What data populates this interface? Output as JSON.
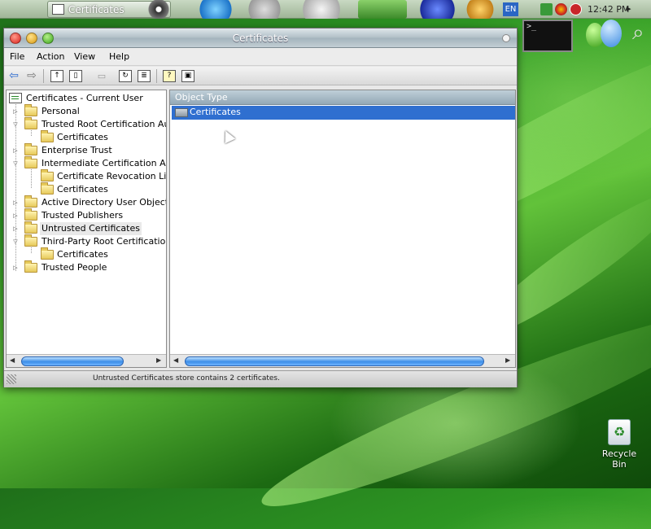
{
  "menubar": {
    "apple_glyph": "",
    "task_label": "Certificates",
    "language": "EN",
    "clock": "12:42 PM",
    "menu_arrow": "▸"
  },
  "desktop": {
    "terminal_prompt": ">_",
    "recycle_bin_label": "Recycle Bin"
  },
  "window": {
    "title": "Certificates",
    "menus": [
      "File",
      "Action",
      "View",
      "Help"
    ]
  },
  "tree": {
    "root": "Certificates - Current User",
    "items": [
      {
        "label": "Personal"
      },
      {
        "label": "Trusted Root Certification Autho"
      },
      {
        "label": "Certificates"
      },
      {
        "label": "Enterprise Trust"
      },
      {
        "label": "Intermediate Certification Autho"
      },
      {
        "label": "Certificate Revocation List"
      },
      {
        "label": "Certificates"
      },
      {
        "label": "Active Directory User Object"
      },
      {
        "label": "Trusted Publishers"
      },
      {
        "label": "Untrusted Certificates"
      },
      {
        "label": "Third-Party Root Certification Au"
      },
      {
        "label": "Certificates"
      },
      {
        "label": "Trusted People"
      }
    ]
  },
  "list": {
    "column_header": "Object Type",
    "rows": [
      {
        "label": "Certificates"
      }
    ]
  },
  "status": {
    "text": "Untrusted Certificates store contains 2 certificates."
  },
  "colors": {
    "selection": "#2f6fd0",
    "desktop_green": "#2f9a24"
  }
}
